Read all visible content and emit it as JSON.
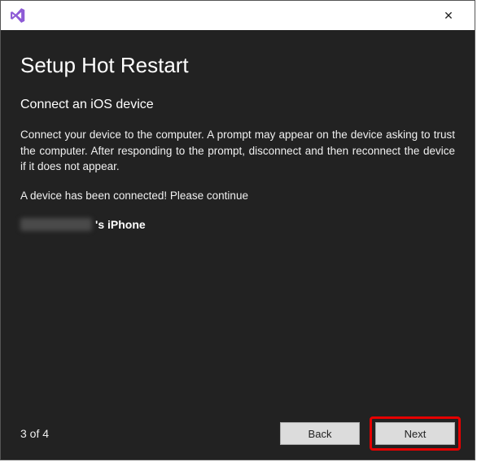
{
  "window": {
    "close_glyph": "✕"
  },
  "wizard": {
    "title": "Setup Hot Restart",
    "subtitle": "Connect an iOS device",
    "instructions": "Connect your device to the computer. A prompt may appear on the device asking to trust the computer. After responding to the prompt, disconnect and then reconnect the device if it does not appear.",
    "status": "A device has been connected! Please continue",
    "device_suffix": "'s iPhone",
    "page_indicator": "3 of 4",
    "buttons": {
      "back": "Back",
      "next": "Next"
    }
  }
}
